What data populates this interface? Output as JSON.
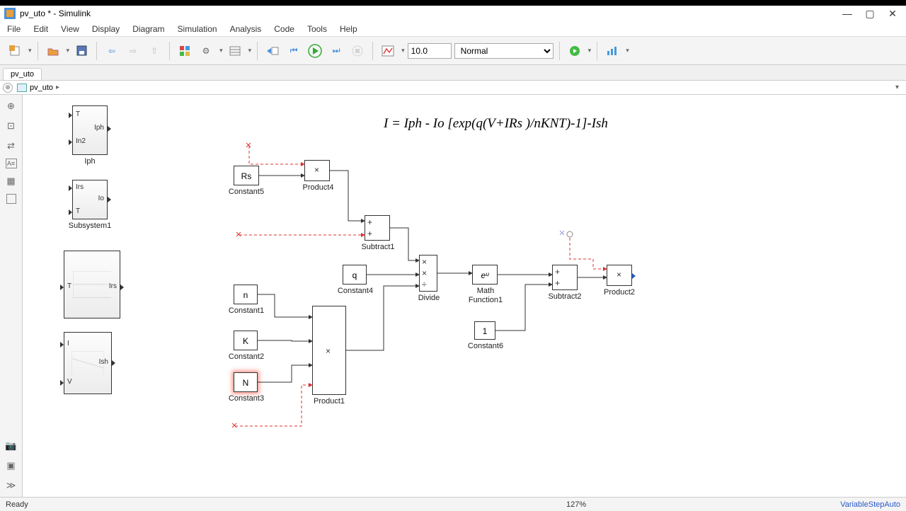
{
  "window": {
    "title": "pv_uto * - Simulink"
  },
  "menu": [
    "File",
    "Edit",
    "View",
    "Display",
    "Diagram",
    "Simulation",
    "Analysis",
    "Code",
    "Tools",
    "Help"
  ],
  "toolbar": {
    "stopTime": "10.0",
    "simMode": "Normal"
  },
  "tab": "pv_uto",
  "breadcrumb": {
    "model": "pv_uto"
  },
  "equation": "I = Iph - Io [exp(q(V+IRs )/nKNT)-1]-Ish",
  "blocks": {
    "iph": {
      "name": "Iph",
      "in1": "T",
      "in2": "In2",
      "out": "Iph"
    },
    "subsystem1": {
      "name": "Subsystem1",
      "in1": "Irs",
      "in2": "T",
      "out": "Io"
    },
    "sub_irs": {
      "in": "T",
      "out": "Irs"
    },
    "sub_ish": {
      "in1": "I",
      "in2": "V",
      "out": "Ish"
    },
    "constant5": {
      "name": "Constant5",
      "val": "Rs"
    },
    "constant4": {
      "name": "Constant4",
      "val": "q"
    },
    "constant1": {
      "name": "Constant1",
      "val": "n"
    },
    "constant2": {
      "name": "Constant2",
      "val": "K"
    },
    "constant3": {
      "name": "Constant3",
      "val": "N"
    },
    "constant6": {
      "name": "Constant6",
      "val": "1"
    },
    "product4": {
      "name": "Product4"
    },
    "product1": {
      "name": "Product1"
    },
    "product2": {
      "name": "Product2"
    },
    "subtract1": {
      "name": "Subtract1"
    },
    "subtract2": {
      "name": "Subtract2"
    },
    "divide": {
      "name": "Divide"
    },
    "math1": {
      "name": "Math\nFunction1",
      "fn": "eᵘ"
    }
  },
  "status": {
    "ready": "Ready",
    "zoom": "127%",
    "solver": "VariableStepAuto"
  }
}
